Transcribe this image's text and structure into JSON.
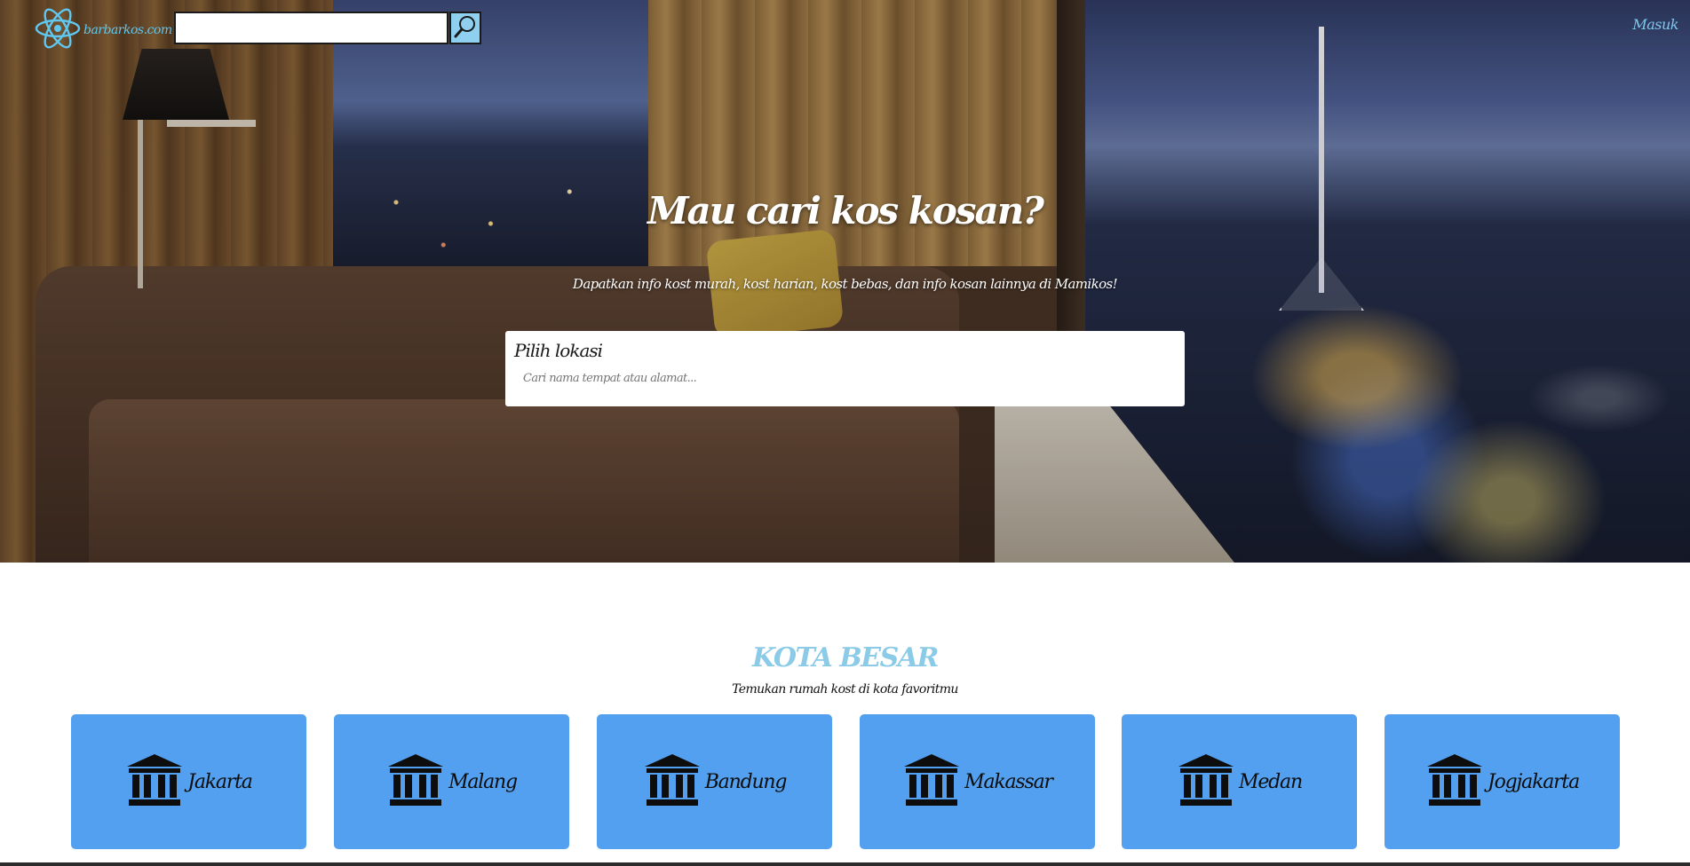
{
  "nav": {
    "brand": "barbarkos.com",
    "logo_icon": "atom-icon",
    "search_value": "",
    "search_icon": "search-icon",
    "login_label": "Masuk",
    "accent_color": "#5fc7f0"
  },
  "hero": {
    "title": "Mau cari kos kosan?",
    "subtitle": "Dapatkan info kost murah, kost harian, kost bebas, dan info kosan lainnya di Mamikos!",
    "location_label": "Pilih lokasi",
    "location_placeholder": "Cari nama tempat atau alamat..."
  },
  "cities_section": {
    "title": "KOTA BESAR",
    "subtitle": "Temukan rumah kost di kota favoritmu",
    "card_color": "#52a0ef",
    "card_icon": "landmark-icon",
    "cities": [
      {
        "name": "Jakarta"
      },
      {
        "name": "Malang"
      },
      {
        "name": "Bandung"
      },
      {
        "name": "Makassar"
      },
      {
        "name": "Medan"
      },
      {
        "name": "Jogjakarta"
      }
    ]
  }
}
